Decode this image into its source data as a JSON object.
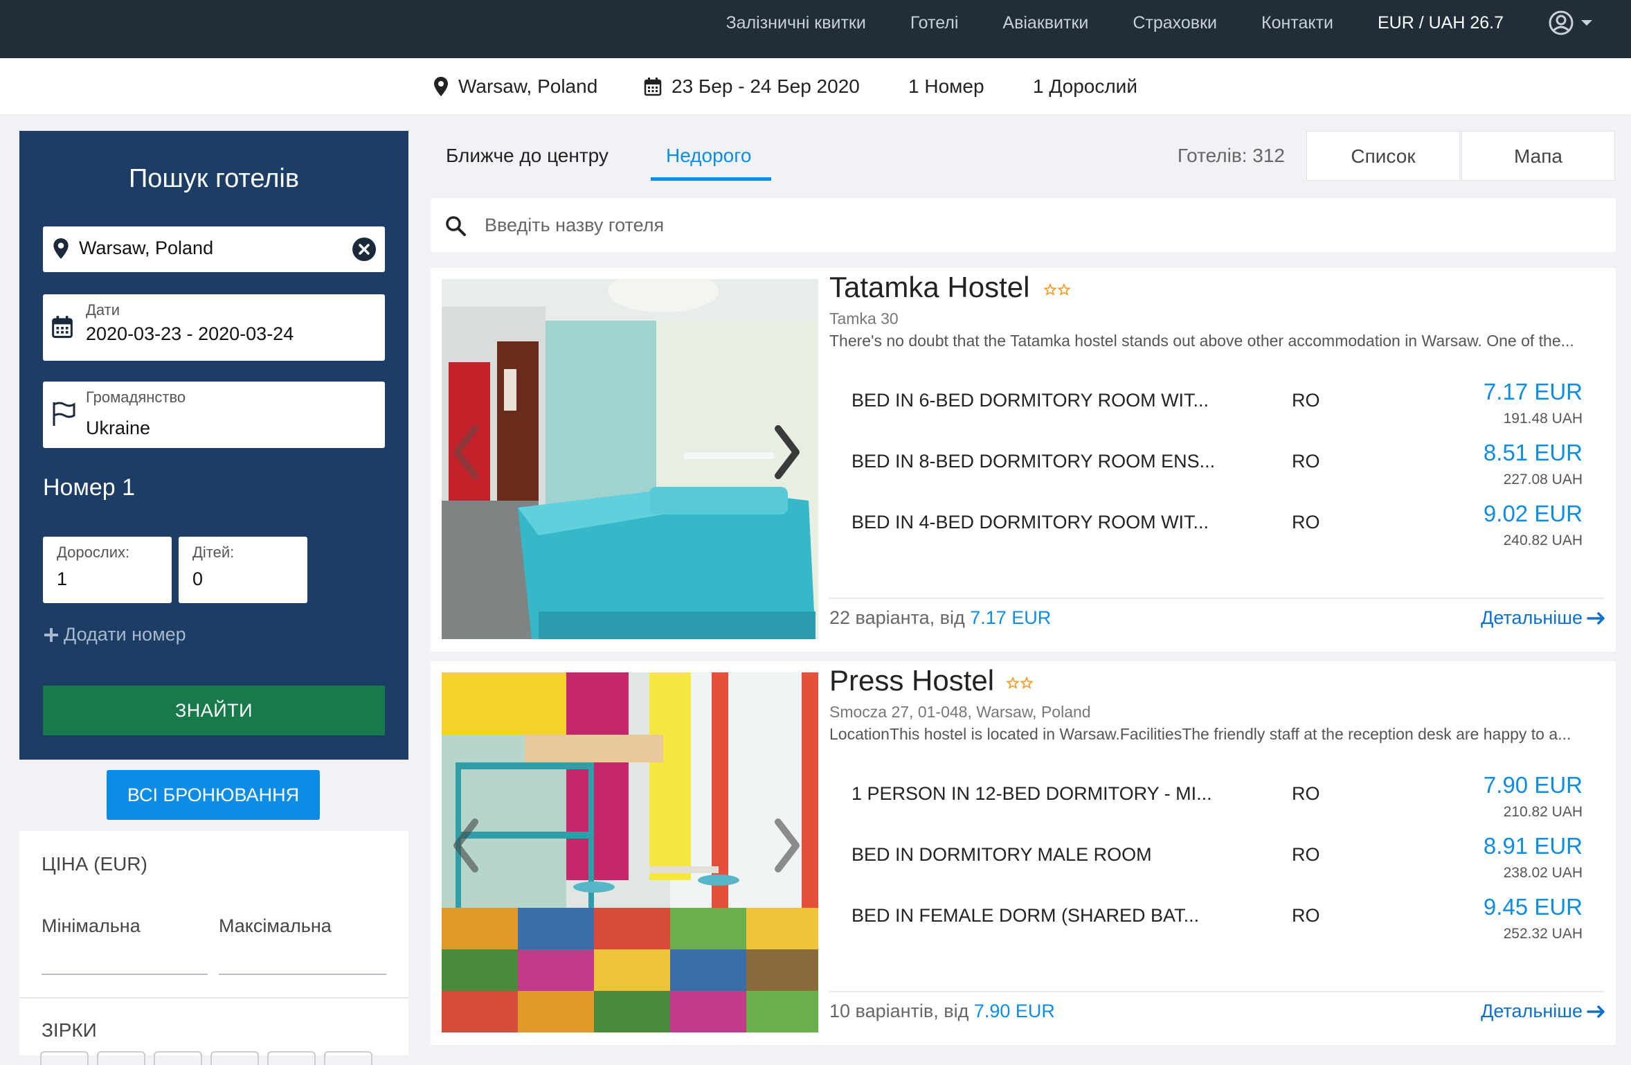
{
  "nav": {
    "links": [
      "Залізничні квитки",
      "Готелі",
      "Авіаквитки",
      "Страховки",
      "Контакти"
    ],
    "currency": "EUR / UAH 26.7"
  },
  "summary": {
    "location": "Warsaw, Poland",
    "dates": "23 Бер - 24 Бер 2020",
    "rooms": "1 Номер",
    "guests": "1 Дорослий"
  },
  "sidebar": {
    "title": "Пошук готелів",
    "location_value": "Warsaw, Poland",
    "dates_label": "Дати",
    "dates_value": "2020-03-23 - 2020-03-24",
    "citizenship_label": "Громадянство",
    "citizenship_value": "Ukraine",
    "room_title": "Номер 1",
    "adults_label": "Дорослих:",
    "adults_value": "1",
    "children_label": "Дітей:",
    "children_value": "0",
    "add_room": "Додати номер",
    "find_button": "ЗНАЙТИ",
    "all_bookings": "ВСІ БРОНЮВАННЯ"
  },
  "filters": {
    "price_title": "ЦІНА (EUR)",
    "min_label": "Мінімальна",
    "max_label": "Максімальна",
    "stars_title": "ЗІРКИ"
  },
  "main": {
    "tab_center": "Ближче до центру",
    "tab_cheap": "Недорого",
    "hotel_count": "Готелів: 312",
    "view_list": "Список",
    "view_map": "Мапа",
    "search_placeholder": "Введіть назву готеля"
  },
  "hotels": [
    {
      "name": "Tatamka Hostel",
      "stars": 2,
      "address": "Tamka 30",
      "description": "There's no doubt that the Tatamka hostel stands out above other accommodation in Warsaw. One of the...",
      "rooms": [
        {
          "name": "BED IN 6-BED DORMITORY ROOM WIT...",
          "meal": "RO",
          "price": "7.17 EUR",
          "uah": "191.48 UAH"
        },
        {
          "name": "BED IN 8-BED DORMITORY ROOM ENS...",
          "meal": "RO",
          "price": "8.51 EUR",
          "uah": "227.08 UAH"
        },
        {
          "name": "BED IN 4-BED DORMITORY ROOM WIT...",
          "meal": "RO",
          "price": "9.02 EUR",
          "uah": "240.82 UAH"
        }
      ],
      "variants_text": "22 варіанта, від",
      "variants_price": "7.17 EUR",
      "more": "Детальніше"
    },
    {
      "name": "Press Hostel",
      "stars": 2,
      "address": "Smocza 27, 01-048, Warsaw, Poland",
      "description": "LocationThis hostel is located in Warsaw.FacilitiesThe friendly staff at the reception desk are happy to a...",
      "rooms": [
        {
          "name": "1 PERSON IN 12-BED DORMITORY - MI...",
          "meal": "RO",
          "price": "7.90 EUR",
          "uah": "210.82 UAH"
        },
        {
          "name": "BED IN DORMITORY MALE ROOM",
          "meal": "RO",
          "price": "8.91 EUR",
          "uah": "238.02 UAH"
        },
        {
          "name": "BED IN FEMALE DORM (SHARED BAT...",
          "meal": "RO",
          "price": "9.45 EUR",
          "uah": "252.32 UAH"
        }
      ],
      "variants_text": "10 варіантів, від",
      "variants_price": "7.90 EUR",
      "more": "Детальніше"
    }
  ],
  "colors": {
    "topbar": "#222d3a",
    "sidebar": "#1b3d66",
    "accent": "#0d8ce6",
    "find_button": "#167a4a",
    "star": "#f0a030"
  },
  "icons": [
    "map-pin-icon",
    "calendar-icon",
    "flag-icon",
    "clear-icon",
    "plus-icon",
    "search-icon",
    "user-circle-icon",
    "caret-down-icon",
    "star-outline-icon",
    "chevron-left-icon",
    "chevron-right-icon",
    "arrow-right-icon"
  ]
}
